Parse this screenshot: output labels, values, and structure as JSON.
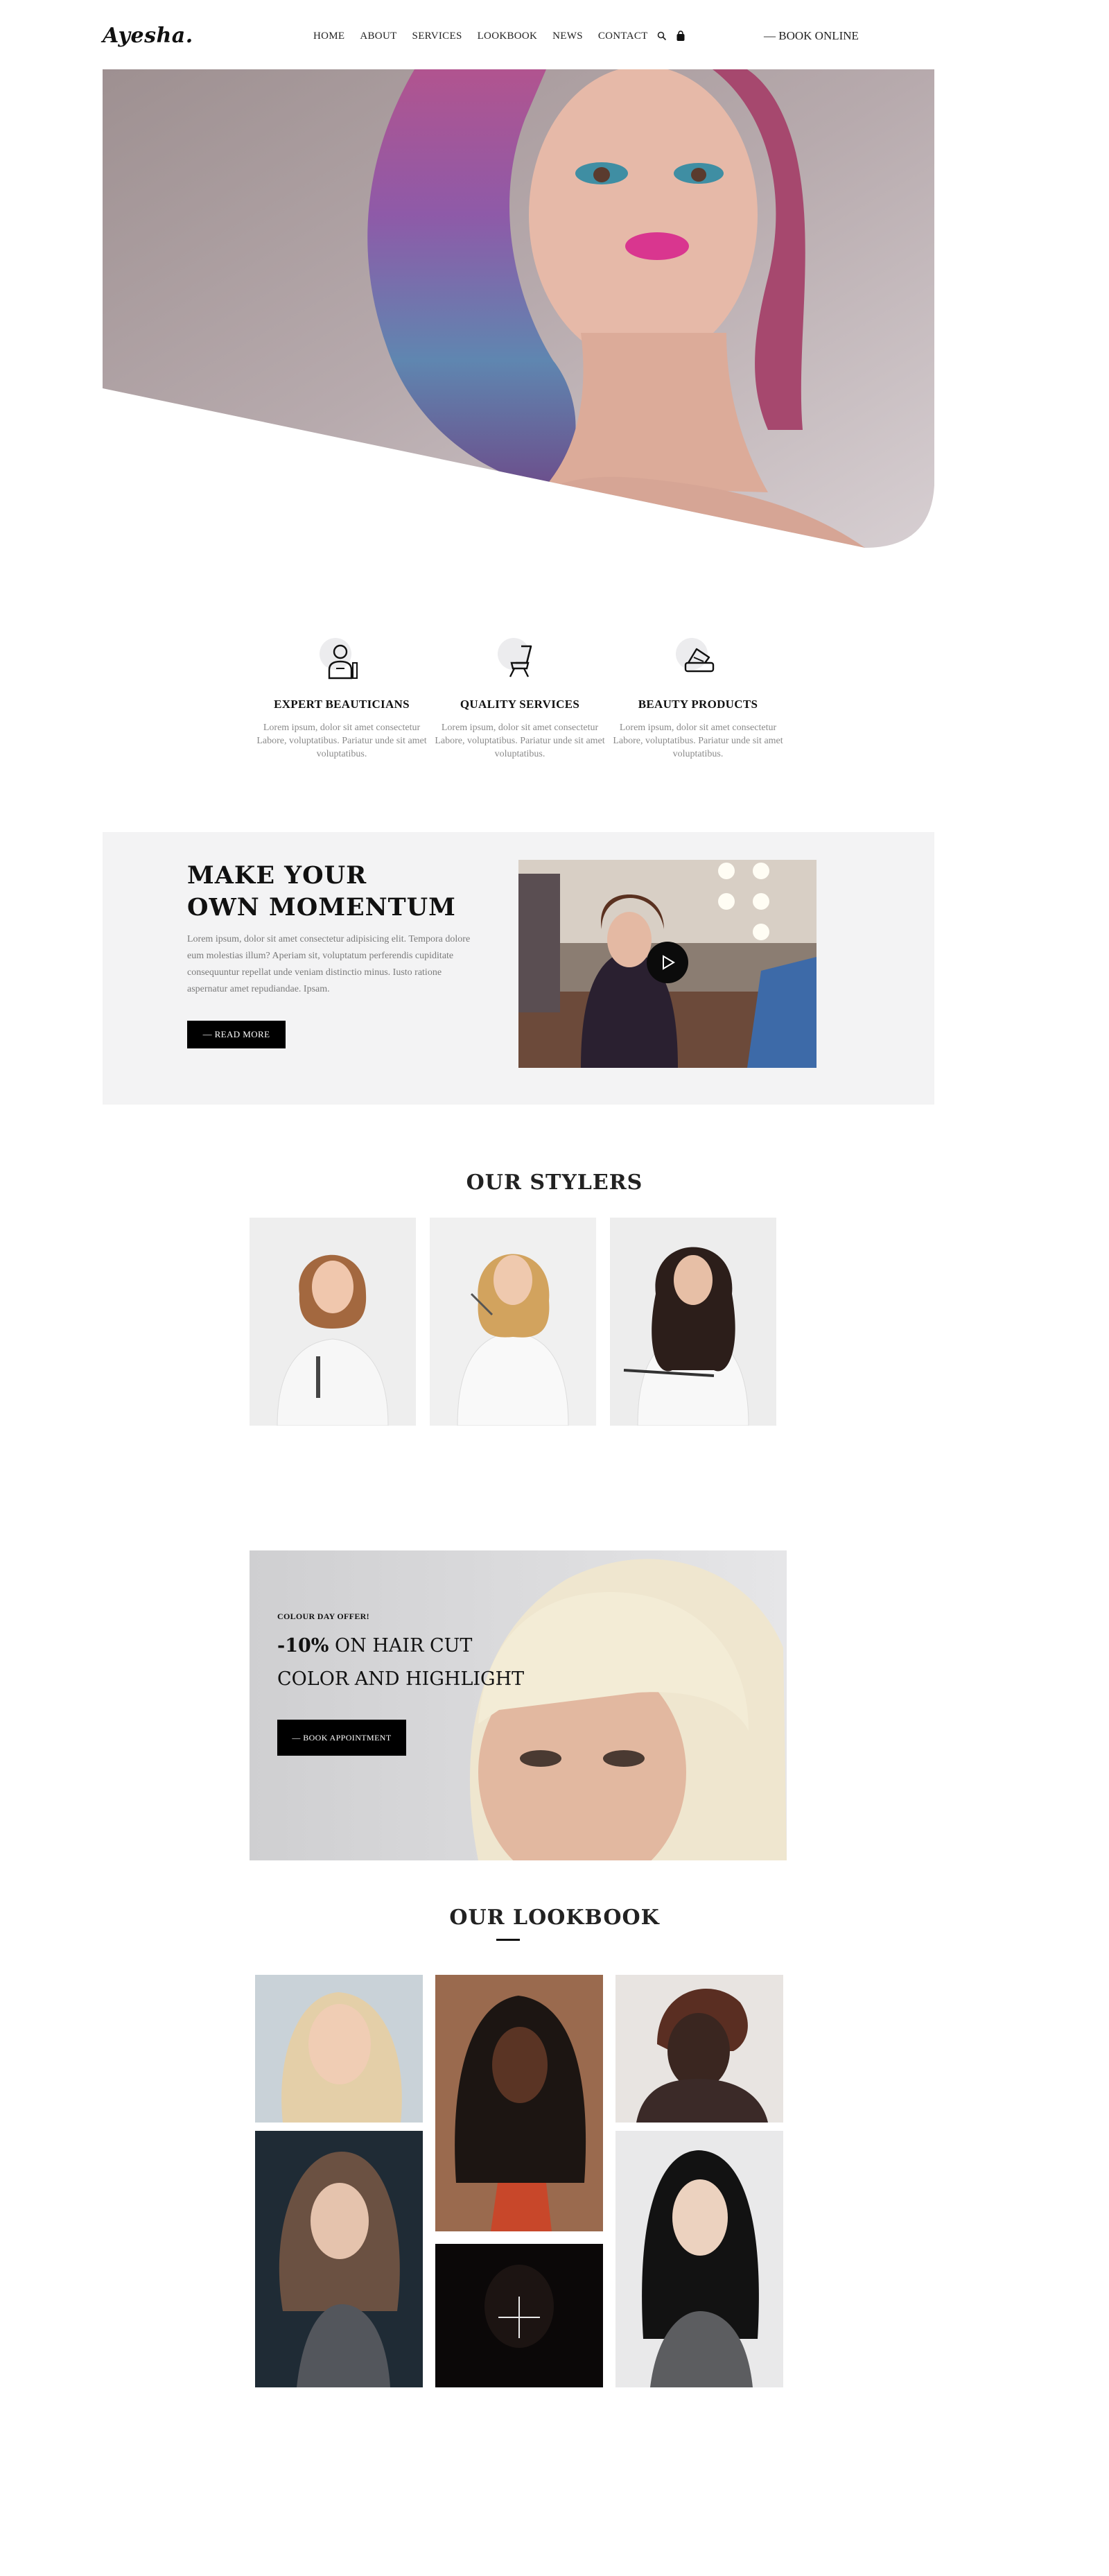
{
  "header": {
    "logo": "Ayesha.",
    "nav": [
      "HOME",
      "ABOUT",
      "SERVICES",
      "LOOKBOOK",
      "NEWS",
      "CONTACT"
    ],
    "book_online": "— BOOK ONLINE",
    "icons": [
      "search-icon",
      "cart-icon"
    ]
  },
  "features": [
    {
      "icon": "beautician-icon",
      "title": "EXPERT BEAUTICIANS",
      "text": "Lorem ipsum, dolor sit amet consectetur Labore, voluptatibus. Pariatur unde sit amet voluptatibus."
    },
    {
      "icon": "salon-chair-icon",
      "title": "QUALITY SERVICES",
      "text": "Lorem ipsum, dolor sit amet consectetur Labore, voluptatibus. Pariatur unde sit amet voluptatibus."
    },
    {
      "icon": "beauty-products-icon",
      "title": "BEAUTY PRODUCTS",
      "text": "Lorem ipsum, dolor sit amet consectetur Labore, voluptatibus. Pariatur unde sit amet voluptatibus."
    }
  ],
  "momentum": {
    "title_line1": "MAKE YOUR",
    "title_line2": "OWN MOMENTUM",
    "text": "Lorem ipsum, dolor sit amet consectetur adipisicing elit. Tempora dolore eum molestias illum? Aperiam sit, voluptatum perferendis cupiditate consequuntur repellat unde veniam distinctio minus. Iusto ratione aspernatur amet repudiandae. Ipsam.",
    "button": "— READ MORE"
  },
  "stylers": {
    "title": "OUR STYLERS"
  },
  "offer": {
    "small": "COLOUR DAY OFFER!",
    "discount": "-10%",
    "line1_rest": " ON HAIR CUT",
    "line2": "COLOR AND HIGHLIGHT",
    "button": "— BOOK APPOINTMENT"
  },
  "lookbook": {
    "title": "OUR LOOKBOOK"
  },
  "colors": {
    "accent": "#000000",
    "panel": "#f3f3f4",
    "muted_text": "#8a8a8a"
  }
}
